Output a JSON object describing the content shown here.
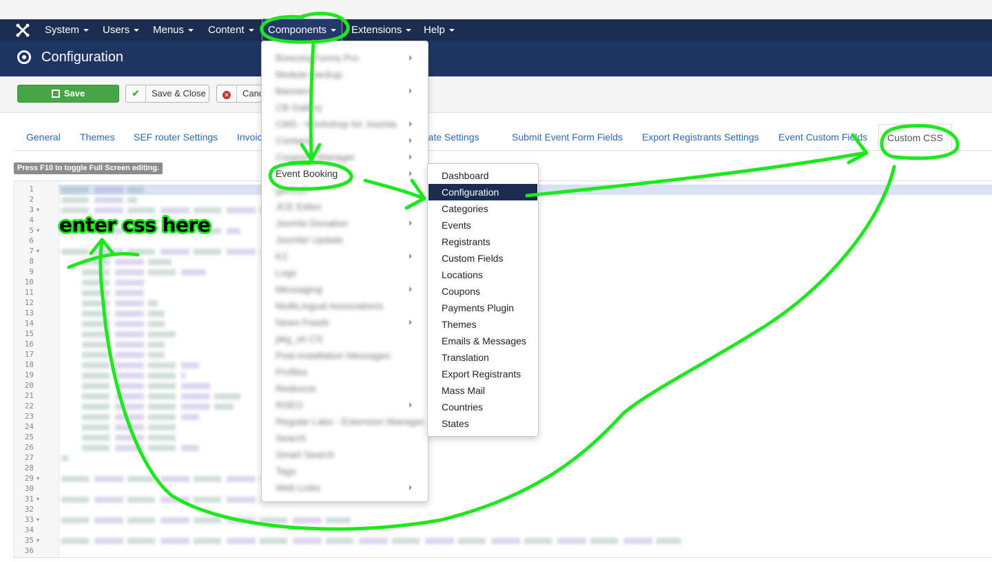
{
  "topnav": {
    "items": [
      {
        "label": "System"
      },
      {
        "label": "Users"
      },
      {
        "label": "Menus"
      },
      {
        "label": "Content"
      },
      {
        "label": "Components"
      },
      {
        "label": "Extensions"
      },
      {
        "label": "Help"
      }
    ]
  },
  "titlebar": {
    "title": "Configuration"
  },
  "toolbar": {
    "save": "Save",
    "save_close": "Save & Close",
    "cancel": "Cancel"
  },
  "tabs": [
    {
      "label": "General"
    },
    {
      "label": "Themes"
    },
    {
      "label": "SEF router Settings"
    },
    {
      "label": "Invoice Settings"
    },
    {
      "label": "Certificate Settings"
    },
    {
      "label": "Submit Event Form Fields"
    },
    {
      "label": "Export Registrants Settings"
    },
    {
      "label": "Event Custom Fields"
    },
    {
      "label": "Custom CSS"
    }
  ],
  "editor": {
    "fullscreen_note": "Press F10 to toggle Full Screen editing.",
    "line_numbers": [
      "1",
      "2",
      "3",
      "4",
      "5",
      "6",
      "7",
      "8",
      "9",
      "10",
      "11",
      "12",
      "13",
      "14",
      "15",
      "16",
      "17",
      "18",
      "19",
      "20",
      "21",
      "22",
      "23",
      "24",
      "25",
      "26",
      "27",
      "28",
      "29",
      "30",
      "31",
      "32",
      "33",
      "34",
      "35",
      "36"
    ]
  },
  "components_menu": {
    "items": [
      {
        "label": "BreezingForms Pro"
      },
      {
        "label": "Module Backup"
      },
      {
        "label": "Banners"
      },
      {
        "label": "CB Gallery"
      },
      {
        "label": "CMS - Workshop for Joomla"
      },
      {
        "label": "Contacts"
      },
      {
        "label": "Coupons Manager"
      },
      {
        "label": "Event Booking"
      },
      {
        "label": "gantry5"
      },
      {
        "label": "JCE Editor"
      },
      {
        "label": "Joomla Donation"
      },
      {
        "label": "Joomla! Update"
      },
      {
        "label": "K2"
      },
      {
        "label": "Logs"
      },
      {
        "label": "Messaging"
      },
      {
        "label": "MultiLingual Associations"
      },
      {
        "label": "News Feeds"
      },
      {
        "label": "pkg_sh CS"
      },
      {
        "label": "Post-installation Messages"
      },
      {
        "label": "Profiles"
      },
      {
        "label": "Redirects"
      },
      {
        "label": "RSEO"
      },
      {
        "label": "Regular Labs - Extension Manager"
      },
      {
        "label": "Search"
      },
      {
        "label": "Smart Search"
      },
      {
        "label": "Tags"
      },
      {
        "label": "Web Links"
      }
    ]
  },
  "eventbooking_submenu": {
    "items": [
      {
        "label": "Dashboard"
      },
      {
        "label": "Configuration"
      },
      {
        "label": "Categories"
      },
      {
        "label": "Events"
      },
      {
        "label": "Registrants"
      },
      {
        "label": "Custom Fields"
      },
      {
        "label": "Locations"
      },
      {
        "label": "Coupons"
      },
      {
        "label": "Payments Plugin"
      },
      {
        "label": "Themes"
      },
      {
        "label": "Emails & Messages"
      },
      {
        "label": "Translation"
      },
      {
        "label": "Export Registrants"
      },
      {
        "label": "Mass Mail"
      },
      {
        "label": "Countries"
      },
      {
        "label": "States"
      }
    ]
  },
  "annotation": {
    "text": "enter css here",
    "color": "#1de81d"
  }
}
